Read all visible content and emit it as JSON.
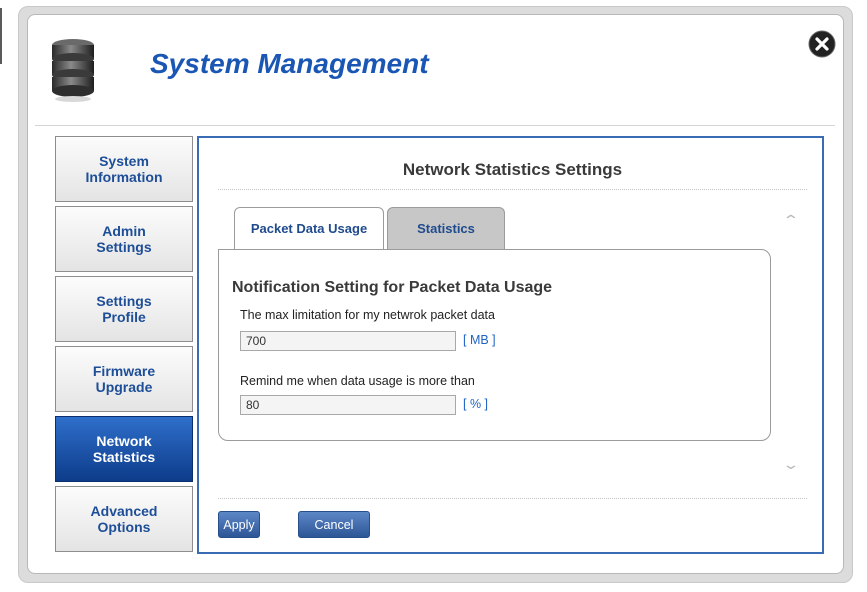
{
  "header": {
    "title": "System Management"
  },
  "sidebar": {
    "items": [
      {
        "label": "System\nInformation",
        "active": false
      },
      {
        "label": "Admin\nSettings",
        "active": false
      },
      {
        "label": "Settings\nProfile",
        "active": false
      },
      {
        "label": "Firmware\nUpgrade",
        "active": false
      },
      {
        "label": "Network\nStatistics",
        "active": true
      },
      {
        "label": "Advanced\nOptions",
        "active": false
      }
    ]
  },
  "panel": {
    "title": "Network Statistics Settings",
    "tabs": [
      {
        "label": "Packet Data Usage",
        "active": true
      },
      {
        "label": "Statistics",
        "active": false
      }
    ],
    "section_title": "Notification Setting for Packet Data Usage",
    "fields": [
      {
        "label": "The max limitation for my netwrok packet data",
        "value": "700",
        "unit": "[ MB ]"
      },
      {
        "label": "Remind me when data usage is more than",
        "value": "80",
        "unit": "[ % ]"
      }
    ]
  },
  "actions": {
    "apply_label": "Apply",
    "cancel_label": "Cancel"
  },
  "icons": {
    "logo": "database-icon",
    "close": "close-icon",
    "scroll_up": "chevron-up-icon",
    "scroll_down": "chevron-down-icon"
  },
  "colors": {
    "title_blue": "#1a56b3",
    "panel_border": "#3a6cb6",
    "active_nav": "#1a4f9f",
    "unit_blue": "#1f63c4",
    "button_blue": "#3e67aa"
  }
}
